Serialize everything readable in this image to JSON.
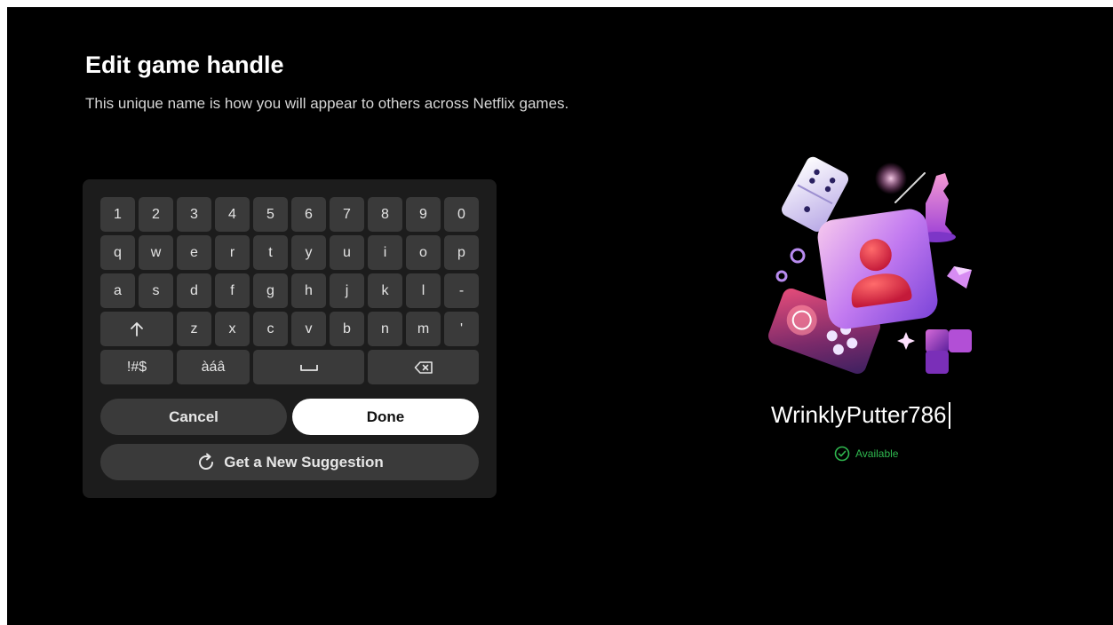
{
  "page": {
    "title": "Edit game handle",
    "subtitle": "This unique name is how you will appear to others across Netflix games."
  },
  "keyboard": {
    "rows": [
      [
        "1",
        "2",
        "3",
        "4",
        "5",
        "6",
        "7",
        "8",
        "9",
        "0"
      ],
      [
        "q",
        "w",
        "e",
        "r",
        "t",
        "y",
        "u",
        "i",
        "o",
        "p"
      ],
      [
        "a",
        "s",
        "d",
        "f",
        "g",
        "h",
        "j",
        "k",
        "l",
        "-"
      ],
      [
        "z",
        "x",
        "c",
        "v",
        "b",
        "n",
        "m",
        "'"
      ]
    ],
    "symbols_label": "!#$",
    "accents_label": "àáâ",
    "shift_icon": "arrow-up-icon",
    "space_icon": "space-bar-icon",
    "backspace_icon": "backspace-icon",
    "cancel_label": "Cancel",
    "done_label": "Done",
    "suggestion_label": "Get a New Suggestion",
    "suggestion_icon": "refresh-icon"
  },
  "profile": {
    "handle": "WrinklyPutter786",
    "status": "Available",
    "status_icon": "check-circle-icon",
    "status_color": "#2fb84f"
  },
  "colors": {
    "background": "#000000",
    "panel": "#1c1c1c",
    "key": "#3a3a3a",
    "accent_pink": "#e0458c",
    "accent_purple": "#8a3fd1"
  }
}
